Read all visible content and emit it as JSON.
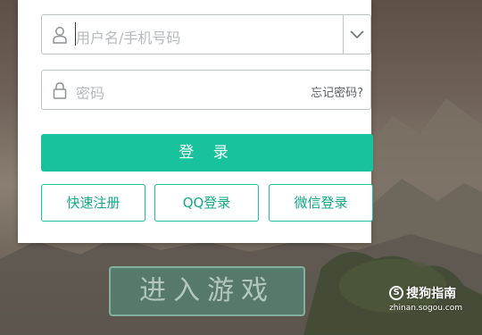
{
  "login_form": {
    "username_placeholder": "用户名/手机号码",
    "password_placeholder": "密码",
    "forgot_password": "忘记密码?",
    "login_button": "登 录",
    "quick_register": "快速注册",
    "qq_login": "QQ登录",
    "wechat_login": "微信登录"
  },
  "game": {
    "enter_button": "进入游戏"
  },
  "watermark": {
    "brand": "搜狗指南",
    "url": "zhinan.sogou.com"
  },
  "colors": {
    "accent": "#17c29c",
    "accent_text": "#13a886",
    "border": "#bfc4c6"
  },
  "icons": {
    "username": "user-icon",
    "password": "lock-icon",
    "dropdown": "chevron-down-icon"
  }
}
